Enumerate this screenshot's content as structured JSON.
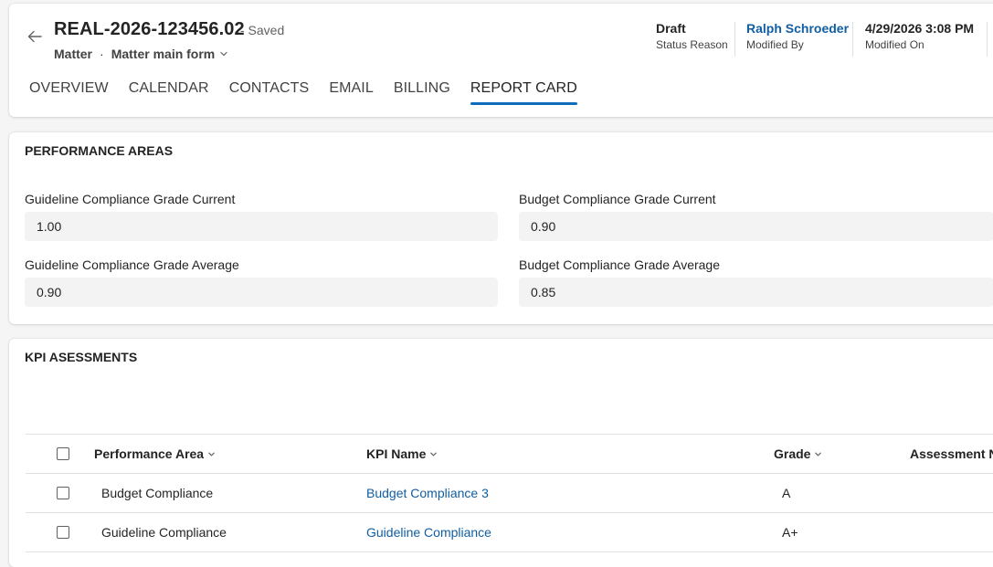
{
  "header": {
    "record_title": "REAL-2026-123456.02",
    "saved_status": "- Saved",
    "entity": "Matter",
    "separator": "·",
    "form_name": "Matter main form",
    "fields": [
      {
        "value": "Draft",
        "label": "Status Reason"
      },
      {
        "value": "Ralph Schroeder",
        "label": "Modified By"
      },
      {
        "value": "4/29/2026 3:08 PM",
        "label": "Modified On"
      }
    ],
    "tabs": [
      "OVERVIEW",
      "CALENDAR",
      "CONTACTS",
      "EMAIL",
      "BILLING",
      "REPORT CARD"
    ],
    "active_tab": "REPORT CARD"
  },
  "performance": {
    "title": "PERFORMANCE AREAS",
    "fields": [
      {
        "label": "Guideline Compliance Grade Current",
        "value": "1.00"
      },
      {
        "label": "Budget Compliance Grade Current",
        "value": "0.90"
      },
      {
        "label": "Guideline Compliance Grade Average",
        "value": "0.90"
      },
      {
        "label": "Budget Compliance Grade Average",
        "value": "0.85"
      }
    ]
  },
  "kpi": {
    "title": "KPI ASESSMENTS",
    "columns": [
      "Performance Area",
      "KPI Name",
      "Grade",
      "Assessment Notes"
    ],
    "rows": [
      {
        "area": "Budget Compliance",
        "kpi": "Budget Compliance 3",
        "grade": "A"
      },
      {
        "area": "Guideline Compliance",
        "kpi": "Guideline Compliance",
        "grade": "A+"
      }
    ]
  },
  "colors": {
    "accent": "#0f6cbd",
    "link": "#115ea3",
    "field_bg": "#f3f3f3"
  },
  "icons": [
    "back-arrow-icon",
    "chevron-down-icon",
    "sort-chevron-icon",
    "checkbox"
  ]
}
